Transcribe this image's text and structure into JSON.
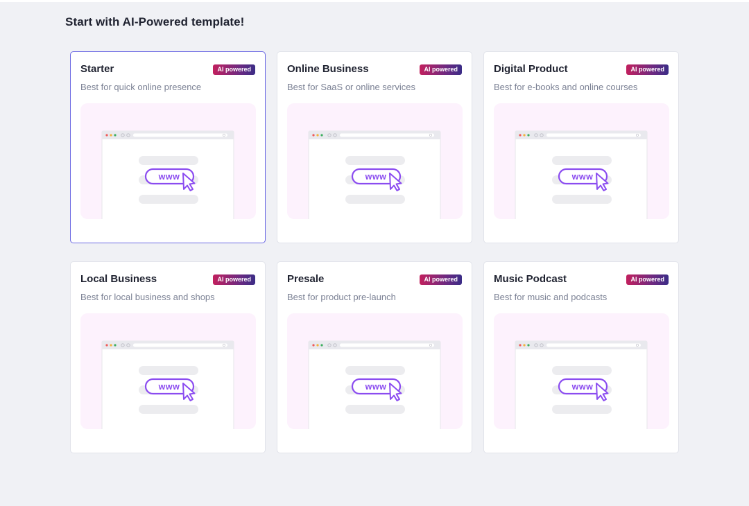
{
  "page": {
    "title": "Start with AI-Powered template!"
  },
  "badge_label": "AI powered",
  "colors": {
    "background": "#f0f1f5",
    "card_background": "#ffffff",
    "selected_border": "#6a67e3",
    "preview_background": "#fdf2fd",
    "accent_purple": "#8b4cf0",
    "badge_gradient_start": "#c2205e",
    "badge_gradient_end": "#3a2c86"
  },
  "selected_template": "Starter",
  "templates": [
    {
      "title": "Starter",
      "description": "Best for quick online presence",
      "badge": "AI powered",
      "selected": true,
      "preview_icon": "www-cursor-icon"
    },
    {
      "title": "Online Business",
      "description": "Best for SaaS or online services",
      "badge": "AI powered",
      "selected": false,
      "preview_icon": "www-cursor-icon"
    },
    {
      "title": "Digital Product",
      "description": "Best for e-books and online courses",
      "badge": "AI powered",
      "selected": false,
      "preview_icon": "www-cursor-icon"
    },
    {
      "title": "Local Business",
      "description": "Best for local business and shops",
      "badge": "AI powered",
      "selected": false,
      "preview_icon": "www-cursor-icon"
    },
    {
      "title": "Presale",
      "description": "Best for product pre-launch",
      "badge": "AI powered",
      "selected": false,
      "preview_icon": "www-cursor-icon"
    },
    {
      "title": "Music Podcast",
      "description": "Best for music and podcasts",
      "badge": "AI powered",
      "selected": false,
      "preview_icon": "www-cursor-icon"
    }
  ]
}
